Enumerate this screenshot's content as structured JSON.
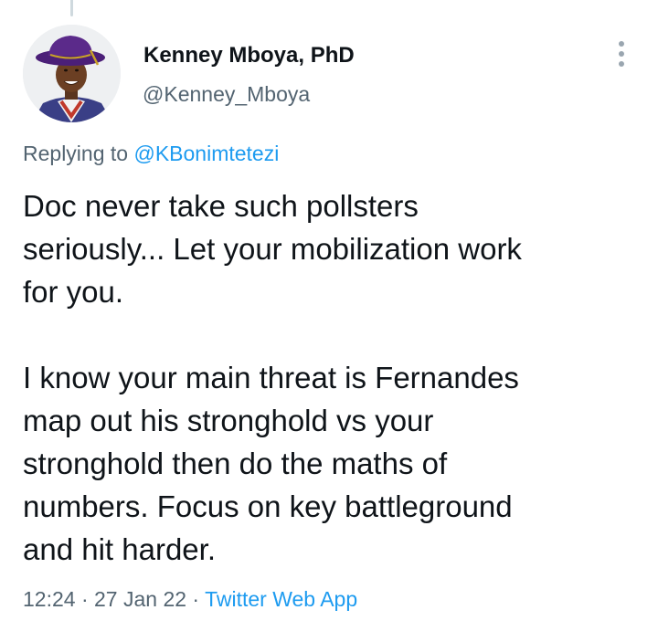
{
  "author": {
    "name": "Kenney Mboya, PhD",
    "handle": "@Kenney_Mboya",
    "avatar_icon": "profile-photo"
  },
  "reply": {
    "prefix": "Replying to ",
    "mention": "@KBonimtetezi"
  },
  "tweet": {
    "paragraphs": [
      "Doc never take such pollsters\nseriously... Let your mobilization work\nfor you.",
      "I know your main threat is Fernandes\nmap out his stronghold vs your\nstronghold then do the maths of\nnumbers. Focus on key battleground\nand hit harder."
    ]
  },
  "meta": {
    "time": "12:24",
    "separator": " · ",
    "date": "27 Jan 22",
    "source": "Twitter Web App"
  },
  "icons": {
    "more": "more-vertical-icon"
  },
  "colors": {
    "text": "#0f1419",
    "secondary": "#536471",
    "link": "#1d9bf0"
  }
}
